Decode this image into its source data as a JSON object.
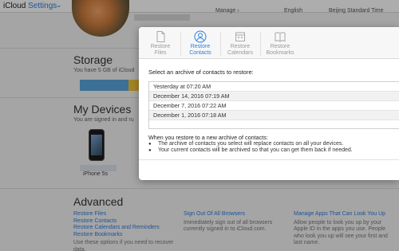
{
  "header": {
    "brand": "iCloud",
    "app": "Settings",
    "col1": "Manage ›",
    "col2": "English",
    "col3": "Beijing Standard Time"
  },
  "storage": {
    "title": "Storage",
    "subtitle": "You have 5 GB of iCloud",
    "used_fraction": 0.82
  },
  "devices": {
    "title": "My Devices",
    "subtitle": "You are signed in and ru",
    "device_name": "iPhone 5s"
  },
  "advanced": {
    "title": "Advanced",
    "links": [
      "Restore Files",
      "Restore Contacts",
      "Restore Calendars and Reminders",
      "Restore Bookmarks"
    ],
    "links_note": "Use these options if you need to recover data.",
    "signout_title": "Sign Out Of All Browsers",
    "signout_text": "Immediately sign out of all browsers currently signed in to iCloud.com.",
    "manage_title": "Manage Apps That Can Look You Up",
    "manage_text": "Allow people to look you up by your Apple ID in the apps you use. People who look you up will see your first and last name."
  },
  "dialog": {
    "tabs": [
      {
        "line1": "Restore",
        "line2": "Files",
        "icon": "file-icon",
        "active": false
      },
      {
        "line1": "Restore",
        "line2": "Contacts",
        "icon": "contacts-icon",
        "active": true
      },
      {
        "line1": "Restore",
        "line2": "Calendars",
        "icon": "calendar-icon",
        "active": false
      },
      {
        "line1": "Restore",
        "line2": "Bookmarks",
        "icon": "bookmark-icon",
        "active": false
      }
    ],
    "prompt": "Select an archive of contacts to restore:",
    "archives": [
      "Yesterday at 07:20 AM",
      "December 14, 2016 07:19 AM",
      "December 7, 2016 07:22 AM",
      "December 1, 2016 07:18 AM"
    ],
    "info_head": "When you restore to a new archive of contacts:",
    "bullets": [
      "The archive of contacts you select will replace contacts on all your devices.",
      "Your current contacts will be archived so that you can get them back if needed."
    ]
  },
  "colors": {
    "accent": "#2a7de1",
    "storage_blue": "#5ba5dd",
    "storage_yellow": "#f0c53a"
  }
}
